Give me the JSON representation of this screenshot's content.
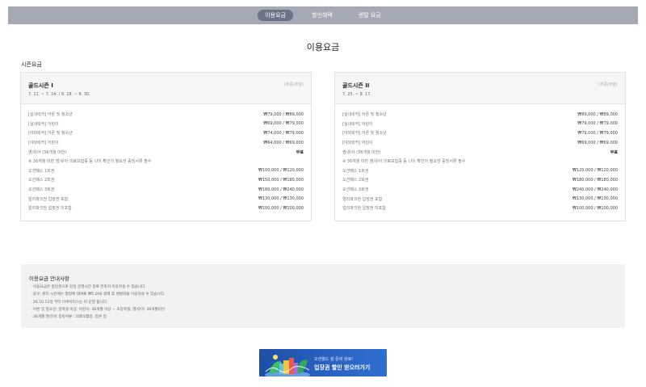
{
  "nav": {
    "tabs": [
      {
        "label": "이용요금",
        "active": true
      },
      {
        "label": "할인혜택",
        "active": false
      },
      {
        "label": "렌탈 요금",
        "active": false
      }
    ]
  },
  "page_title": "이용요금",
  "section_label": "시즌요금",
  "cards": [
    {
      "title": "골드시즌 I",
      "note": "(주중/주말)",
      "dates": "7. 11. ~ 7. 24. / 8. 18. ~ 8. 30.",
      "rows": [
        {
          "label": "[실내락커] 어른 및 청소년",
          "value": "₩79,000 / ₩89,000",
          "bold": false
        },
        {
          "label": "[실내락커] 어린이",
          "value": "₩69,000 / ₩79,000",
          "bold": false
        },
        {
          "label": "[야외락커] 어른 및 청소년",
          "value": "₩74,000 / ₩79,000",
          "bold": false
        },
        {
          "label": "[야외락커] 어린이",
          "value": "₩64,000 / ₩69,000",
          "bold": false
        },
        {
          "label": "영/유아 (36개월 미만)",
          "value": "무료",
          "bold": true
        },
        {
          "label": "※ 36개월 미만 영/유아 의료보험증 등 나이 확인이 필요한 증빙서류 필수",
          "value": "",
          "bold": false
        },
        {
          "label": "오션패스 1회권",
          "value": "₩100,000 / ₩120,000",
          "bold": false
        },
        {
          "label": "오션패스 2회권",
          "value": "₩150,000 / ₩180,000",
          "bold": false
        },
        {
          "label": "오션패스 3회권",
          "value": "₩180,000 / ₩240,000",
          "bold": false
        },
        {
          "label": "얼리파크권 입장권 포함",
          "value": "₩130,000 / ₩130,000",
          "bold": false
        },
        {
          "label": "얼리파크권 입장권 미포함",
          "value": "₩100,000 / ₩100,000",
          "bold": false
        }
      ]
    },
    {
      "title": "골드시즌 II",
      "note": "(주중/주말)",
      "dates": "7. 25. ~ 8. 17.",
      "rows": [
        {
          "label": "[실내락커] 어른 및 청소년",
          "value": "₩89,000 / ₩89,000",
          "bold": false
        },
        {
          "label": "[실내락커] 어린이",
          "value": "₩79,000 / ₩79,000",
          "bold": false
        },
        {
          "label": "[야외락커] 어른 및 청소년",
          "value": "₩79,000 / ₩79,000",
          "bold": false
        },
        {
          "label": "[야외락커] 어린이",
          "value": "₩69,000 / ₩69,000",
          "bold": false
        },
        {
          "label": "영/유아 (36개월 미만)",
          "value": "무료",
          "bold": true
        },
        {
          "label": "※ 36개월 미만 영/유아 의료보험증 등 나이 확인이 필요한 증빙서류 필수",
          "value": "",
          "bold": false
        },
        {
          "label": "오션패스 1회권",
          "value": "₩120,000 / ₩120,000",
          "bold": false
        },
        {
          "label": "오션패스 2회권",
          "value": "₩180,000 / ₩180,000",
          "bold": false
        },
        {
          "label": "오션패스 3회권",
          "value": "₩240,000 / ₩240,000",
          "bold": false
        },
        {
          "label": "얼리파크권 입장권 포함",
          "value": "₩130,000 / ₩130,000",
          "bold": false
        },
        {
          "label": "얼리파크권 입장권 미포함",
          "value": "₩100,000 / ₩100,000",
          "bold": false
        }
      ]
    }
  ],
  "notice": {
    "title": "이용요금 안내사항",
    "lines": [
      "· 이용요금은 종일권으로 당일 운영시간 종료 전까지 이용하실 수 있습니다.",
      "· 중우, 윈터 시즌에는 평일에 대여료 ₩5,000 결제 후 렌탈락을 이용하실 수 있습니다.",
      "· 26.10.12일 부터 아쿠아리스는 미 운영 됩니다.",
      "· 어른 및 청소년: 중학생 이상, 어린이: 36개월 이상 ~ 초등학생, 영/유아: 36개월미만",
      "· 36개월 영/유아 증빙서류 : 의료보험증, 등본 등"
    ]
  },
  "banner": {
    "small_text": "오션월드 잘 준비 완료!",
    "big_text": "입장권 할인 받으러가기"
  }
}
